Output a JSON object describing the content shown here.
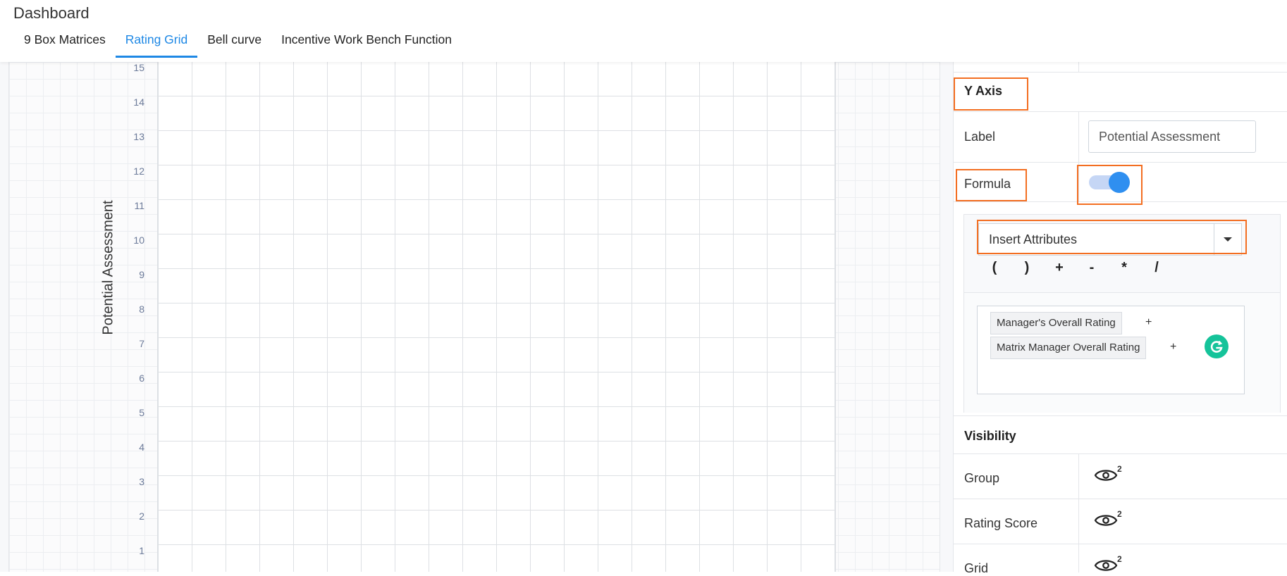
{
  "app": {
    "title": "Dashboard"
  },
  "tabs": [
    {
      "label": "9 Box Matrices",
      "active": false
    },
    {
      "label": "Rating Grid",
      "active": true
    },
    {
      "label": "Bell curve",
      "active": false
    },
    {
      "label": "Incentive Work Bench Function",
      "active": false
    }
  ],
  "grid": {
    "y_axis_label": "Potential Assessment",
    "y_ticks": [
      "15",
      "14",
      "13",
      "12",
      "11",
      "10",
      "9",
      "8",
      "7",
      "6",
      "5",
      "4",
      "3",
      "2",
      "1"
    ]
  },
  "panel": {
    "y_axis": {
      "heading": "Y Axis",
      "label_field_label": "Label",
      "label_field_value": "Potential Assessment",
      "formula_label": "Formula",
      "formula_enabled": true
    },
    "formula": {
      "insert_attributes": "Insert Attributes",
      "operators": [
        "(",
        ")",
        "+",
        "-",
        "*",
        "/"
      ],
      "expression": [
        {
          "attribute": "Manager's Overall Rating",
          "operator": "+"
        },
        {
          "attribute": "Matrix Manager Overall Rating",
          "operator": "+"
        }
      ]
    },
    "visibility": {
      "heading": "Visibility",
      "items": [
        {
          "label": "Group",
          "count": "2"
        },
        {
          "label": "Rating Score",
          "count": "2"
        },
        {
          "label": "Grid",
          "count": "2"
        }
      ]
    }
  },
  "colors": {
    "accent": "#1e88e5",
    "highlight": "#f36e21",
    "toggle": "#2f8ff0",
    "grammarly": "#15c39a"
  },
  "icons": {
    "visibility": "eye-icon",
    "dropdown": "caret-down-icon",
    "grammarly": "grammarly-icon"
  }
}
